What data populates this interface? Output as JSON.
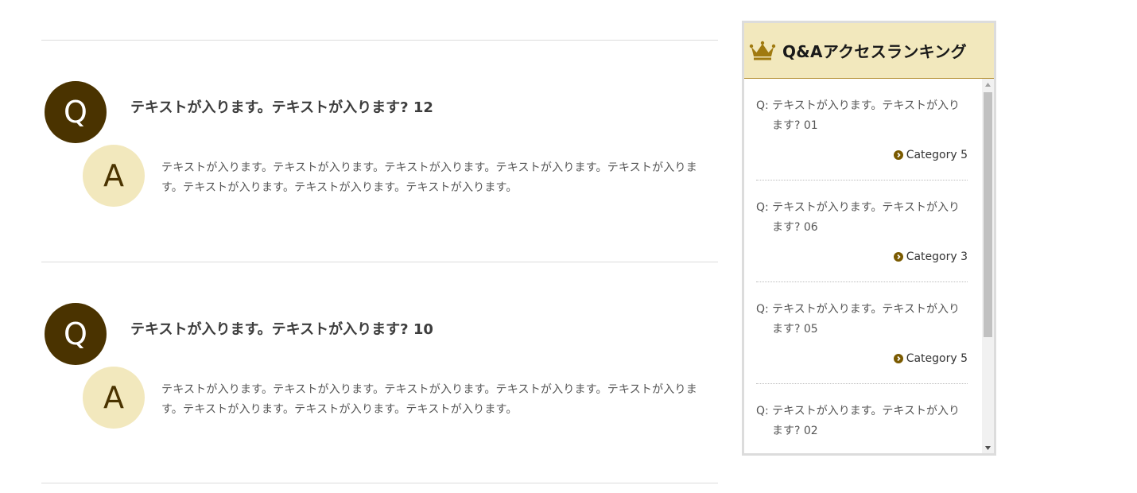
{
  "qa_items": [
    {
      "q_badge": "Q",
      "question": "テキストが入ります。テキストが入ります? 12",
      "a_badge": "A",
      "answer": "テキストが入ります。テキストが入ります。テキストが入ります。テキストが入ります。テキストが入ります。テキストが入ります。テキストが入ります。テキストが入ります。"
    },
    {
      "q_badge": "Q",
      "question": "テキストが入ります。テキストが入ります? 10",
      "a_badge": "A",
      "answer": "テキストが入ります。テキストが入ります。テキストが入ります。テキストが入ります。テキストが入ります。テキストが入ります。テキストが入ります。テキストが入ります。"
    }
  ],
  "ranking": {
    "title": "Q&Aアクセスランキング",
    "icon": "crown-icon",
    "items": [
      {
        "question": "Q: テキストが入ります。テキストが入ります? 01",
        "category": "Category 5"
      },
      {
        "question": "Q: テキストが入ります。テキストが入ります? 06",
        "category": "Category 3"
      },
      {
        "question": "Q: テキストが入ります。テキストが入ります? 05",
        "category": "Category 5"
      },
      {
        "question": "Q: テキストが入ります。テキストが入ります? 02",
        "category": ""
      }
    ]
  },
  "colors": {
    "q_badge_bg": "#4a3300",
    "a_badge_bg": "#f2e8bd",
    "header_bg": "#f2e8bd",
    "accent": "#7a5a00",
    "crown": "#a07a10"
  }
}
